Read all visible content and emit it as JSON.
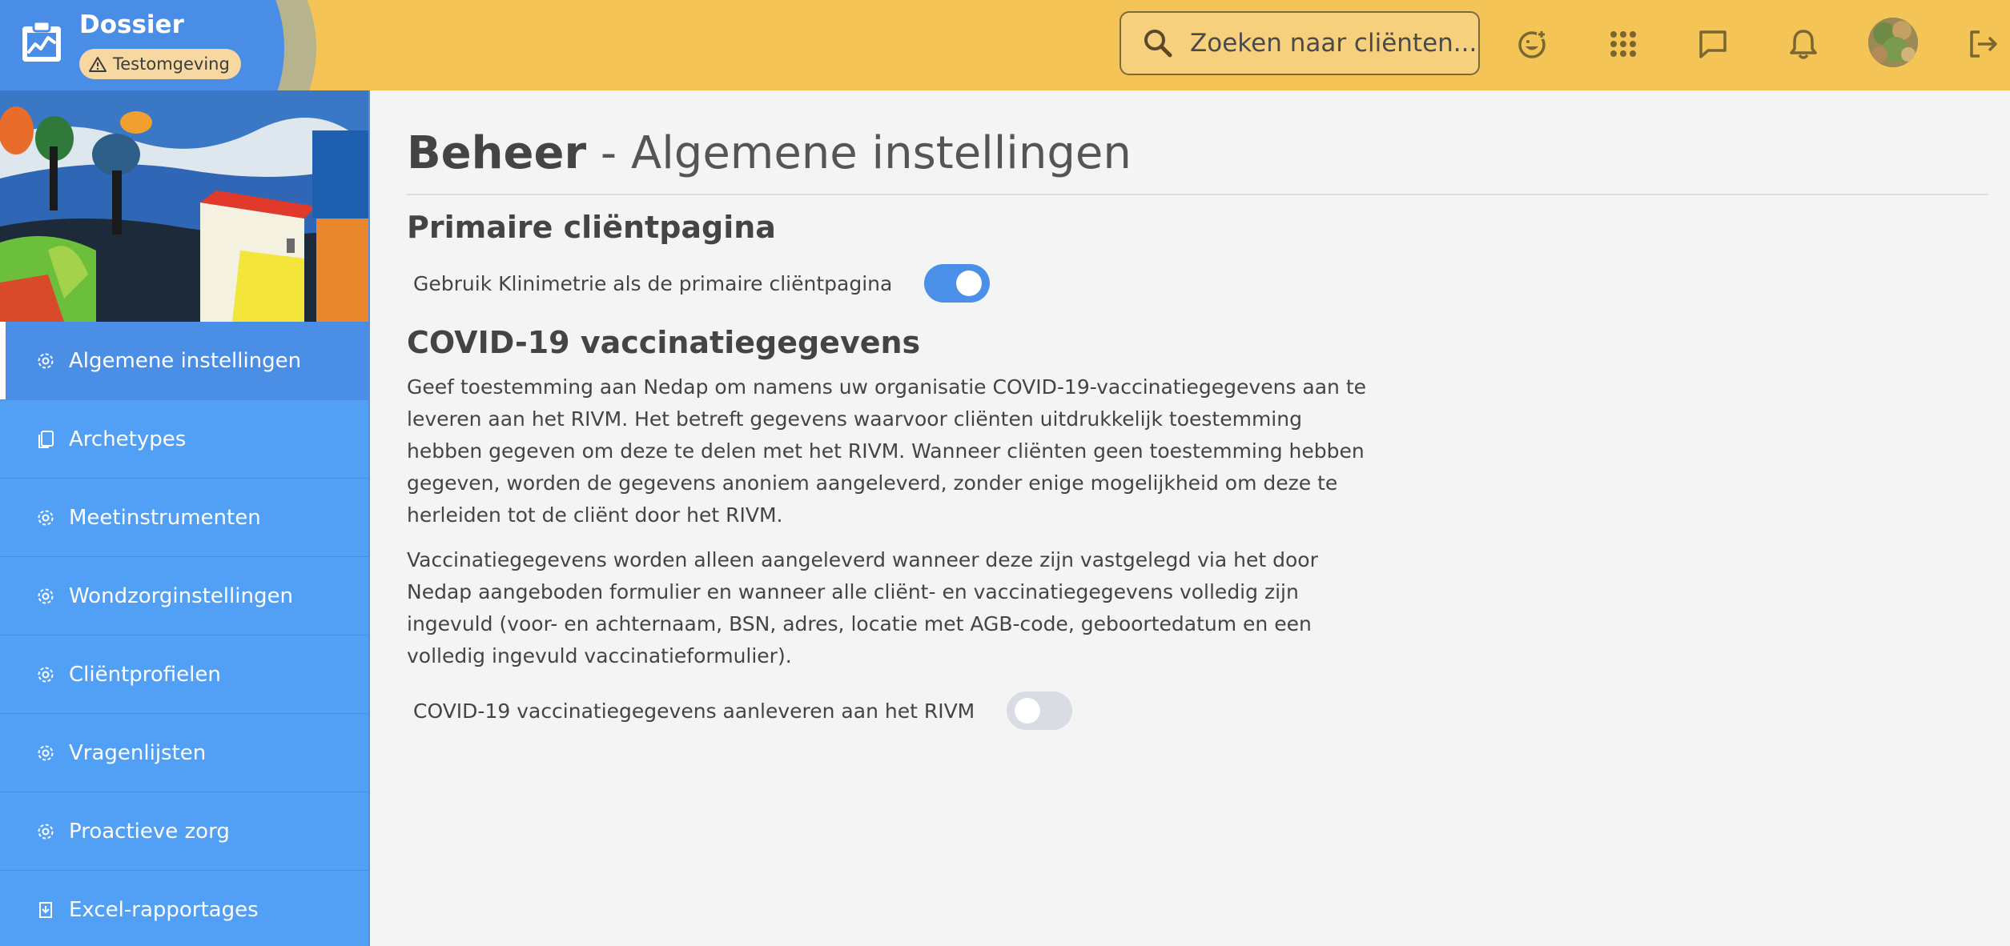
{
  "app": {
    "title": "Dossier",
    "environment_badge": "Testomgeving"
  },
  "search": {
    "placeholder": "Zoeken naar cliënten..."
  },
  "topbar_icons": [
    "feedback-face-icon",
    "apps-grid-icon",
    "chat-icon",
    "bell-icon",
    "logout-icon"
  ],
  "sidebar": {
    "items": [
      {
        "label": "Algemene instellingen",
        "icon": "gear-icon",
        "active": true
      },
      {
        "label": "Archetypes",
        "icon": "document-copy-icon",
        "active": false
      },
      {
        "label": "Meetinstrumenten",
        "icon": "gear-icon",
        "active": false
      },
      {
        "label": "Wondzorginstellingen",
        "icon": "gear-icon",
        "active": false
      },
      {
        "label": "Cliëntprofielen",
        "icon": "gear-icon",
        "active": false
      },
      {
        "label": "Vragenlijsten",
        "icon": "gear-icon",
        "active": false
      },
      {
        "label": "Proactieve zorg",
        "icon": "gear-icon",
        "active": false
      },
      {
        "label": "Excel-rapportages",
        "icon": "download-icon",
        "active": false
      }
    ]
  },
  "main": {
    "title_bold": "Beheer",
    "title_rest": " - Algemene instellingen",
    "section1": {
      "heading": "Primaire cliëntpagina",
      "toggle_label": "Gebruik Klinimetrie als de primaire cliëntpagina",
      "toggle_on": true
    },
    "section2": {
      "heading": "COVID-19 vaccinatiegegevens",
      "paragraph1": "Geef toestemming aan Nedap om namens uw organisatie COVID-19-vaccinatiegegevens aan te leveren aan het RIVM. Het betreft gegevens waarvoor cliënten uitdrukkelijk toestemming hebben gegeven om deze te delen met het RIVM. Wanneer cliënten geen toestemming hebben gegeven, worden de gegevens anoniem aangeleverd, zonder enige mogelijkheid om deze te herleiden tot de cliënt door het RIVM.",
      "paragraph2": "Vaccinatiegegevens worden alleen aangeleverd wanneer deze zijn vastgelegd via het door Nedap aangeboden formulier en wanneer alle cliënt- en vaccinatiegegevens volledig zijn ingevuld (voor- en achternaam, BSN, adres, locatie met AGB-code, geboortedatum en een volledig ingevuld vaccinatieformulier).",
      "toggle_label": "COVID-19 vaccinatiegegevens aanleveren aan het RIVM",
      "toggle_on": false
    }
  },
  "colors": {
    "topbar": "#f5c457",
    "sidebar": "#52a0f5",
    "sidebar_active": "#4b8ee6",
    "toggle_on": "#4a8fe8",
    "toggle_off": "#d9dde3"
  }
}
